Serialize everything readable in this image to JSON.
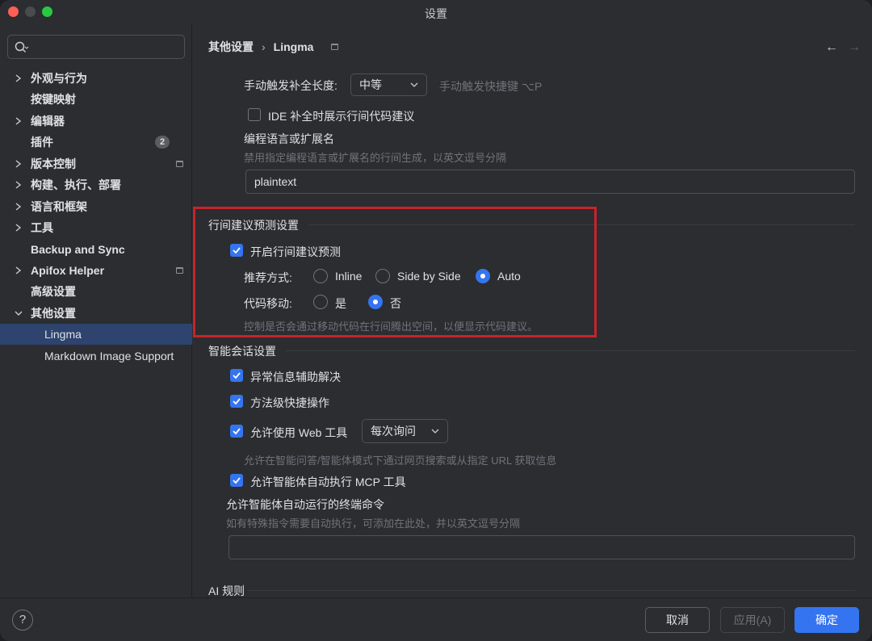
{
  "window": {
    "title": "设置"
  },
  "sidebar": {
    "search_placeholder": "",
    "items": [
      {
        "label": "外观与行为",
        "expandable": true,
        "expanded": false
      },
      {
        "label": "按键映射",
        "expandable": false
      },
      {
        "label": "编辑器",
        "expandable": true,
        "expanded": false
      },
      {
        "label": "插件",
        "expandable": false,
        "badge": "2"
      },
      {
        "label": "版本控制",
        "expandable": true,
        "expanded": false,
        "pinned": true
      },
      {
        "label": "构建、执行、部署",
        "expandable": true,
        "expanded": false
      },
      {
        "label": "语言和框架",
        "expandable": true,
        "expanded": false
      },
      {
        "label": "工具",
        "expandable": true,
        "expanded": false
      },
      {
        "label": "Backup and Sync",
        "expandable": false
      },
      {
        "label": "Apifox Helper",
        "expandable": true,
        "expanded": false,
        "pinned": true
      },
      {
        "label": "高级设置",
        "expandable": false
      },
      {
        "label": "其他设置",
        "expandable": true,
        "expanded": true
      },
      {
        "label": "Lingma",
        "child": true,
        "selected": true
      },
      {
        "label": "Markdown Image Support",
        "child": true
      }
    ]
  },
  "breadcrumb": {
    "parent": "其他设置",
    "separator": "›",
    "current": "Lingma"
  },
  "completion": {
    "length_label": "手动触发补全长度:",
    "length_value": "中等",
    "shortcut_hint": "手动触发快捷键 ⌥P",
    "ide_inline_label": "IDE 补全时展示行间代码建议",
    "ide_inline_checked": false,
    "lang_title": "编程语言或扩展名",
    "lang_hint": "禁用指定编程语言或扩展名的行间生成，以英文逗号分隔",
    "lang_value": "plaintext"
  },
  "prediction": {
    "section_title": "行间建议预测设置",
    "enable_label": "开启行间建议预测",
    "enable_checked": true,
    "recommend_label": "推荐方式:",
    "recommend_options": [
      "Inline",
      "Side by Side",
      "Auto"
    ],
    "recommend_selected": "Auto",
    "move_label": "代码移动:",
    "move_options": [
      "是",
      "否"
    ],
    "move_selected": "否",
    "move_hint": "控制是否会通过移动代码在行间腾出空间，以便显示代码建议。"
  },
  "chat": {
    "section_title": "智能会话设置",
    "exception_label": "异常信息辅助解决",
    "exception_checked": true,
    "method_label": "方法级快捷操作",
    "method_checked": true,
    "web_label": "允许使用 Web 工具",
    "web_checked": true,
    "web_mode": "每次询问",
    "web_hint": "允许在智能问答/智能体模式下通过网页搜索或从指定 URL 获取信息",
    "mcp_label": "允许智能体自动执行 MCP 工具",
    "mcp_checked": true,
    "terminal_title": "允许智能体自动运行的终端命令",
    "terminal_hint": "如有特殊指令需要自动执行，可添加在此处，并以英文逗号分隔",
    "terminal_value": ""
  },
  "ai_rules": {
    "section_title": "AI 规则"
  },
  "footer": {
    "help_label": "?",
    "cancel_label": "取消",
    "apply_label": "应用(A)",
    "ok_label": "确定"
  },
  "colors": {
    "accent": "#3574f0",
    "highlight_border": "#c8232c",
    "selection": "#2e436e"
  }
}
